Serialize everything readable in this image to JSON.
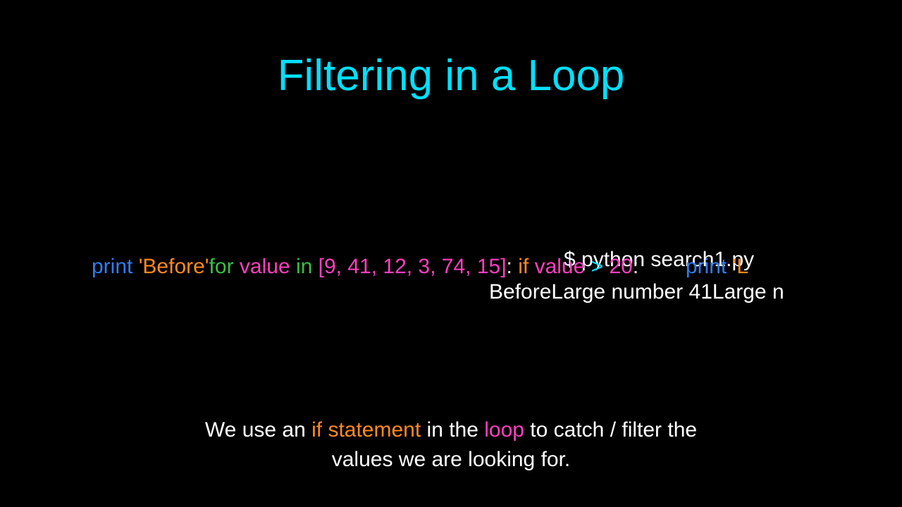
{
  "title": "Filtering in a Loop",
  "code": {
    "print1": "print",
    "str_before": " 'Before'",
    "for_kw": "for ",
    "value1": "value ",
    "in_kw": "in ",
    "list_open": "[",
    "list_vals": "9, 41, 12, 3, 74, 15",
    "list_close": "]",
    "colon1": ": ",
    "if_kw": "    if ",
    "value2": "value ",
    "gt": "> ",
    "num20": "20",
    "colon2": ":",
    "print2": "print",
    "str_L": " 'L"
  },
  "terminal": {
    "cmd": "$ python search1.py",
    "out_before": "Before",
    "out_large1": "Large number 41",
    "out_large2": "Large n"
  },
  "body": {
    "l1a": "We use an ",
    "l1b": "if statement",
    "l1c": " in the ",
    "l1d": "loop",
    "l1e": " to catch / filter the",
    "l2": "values we are looking for."
  }
}
